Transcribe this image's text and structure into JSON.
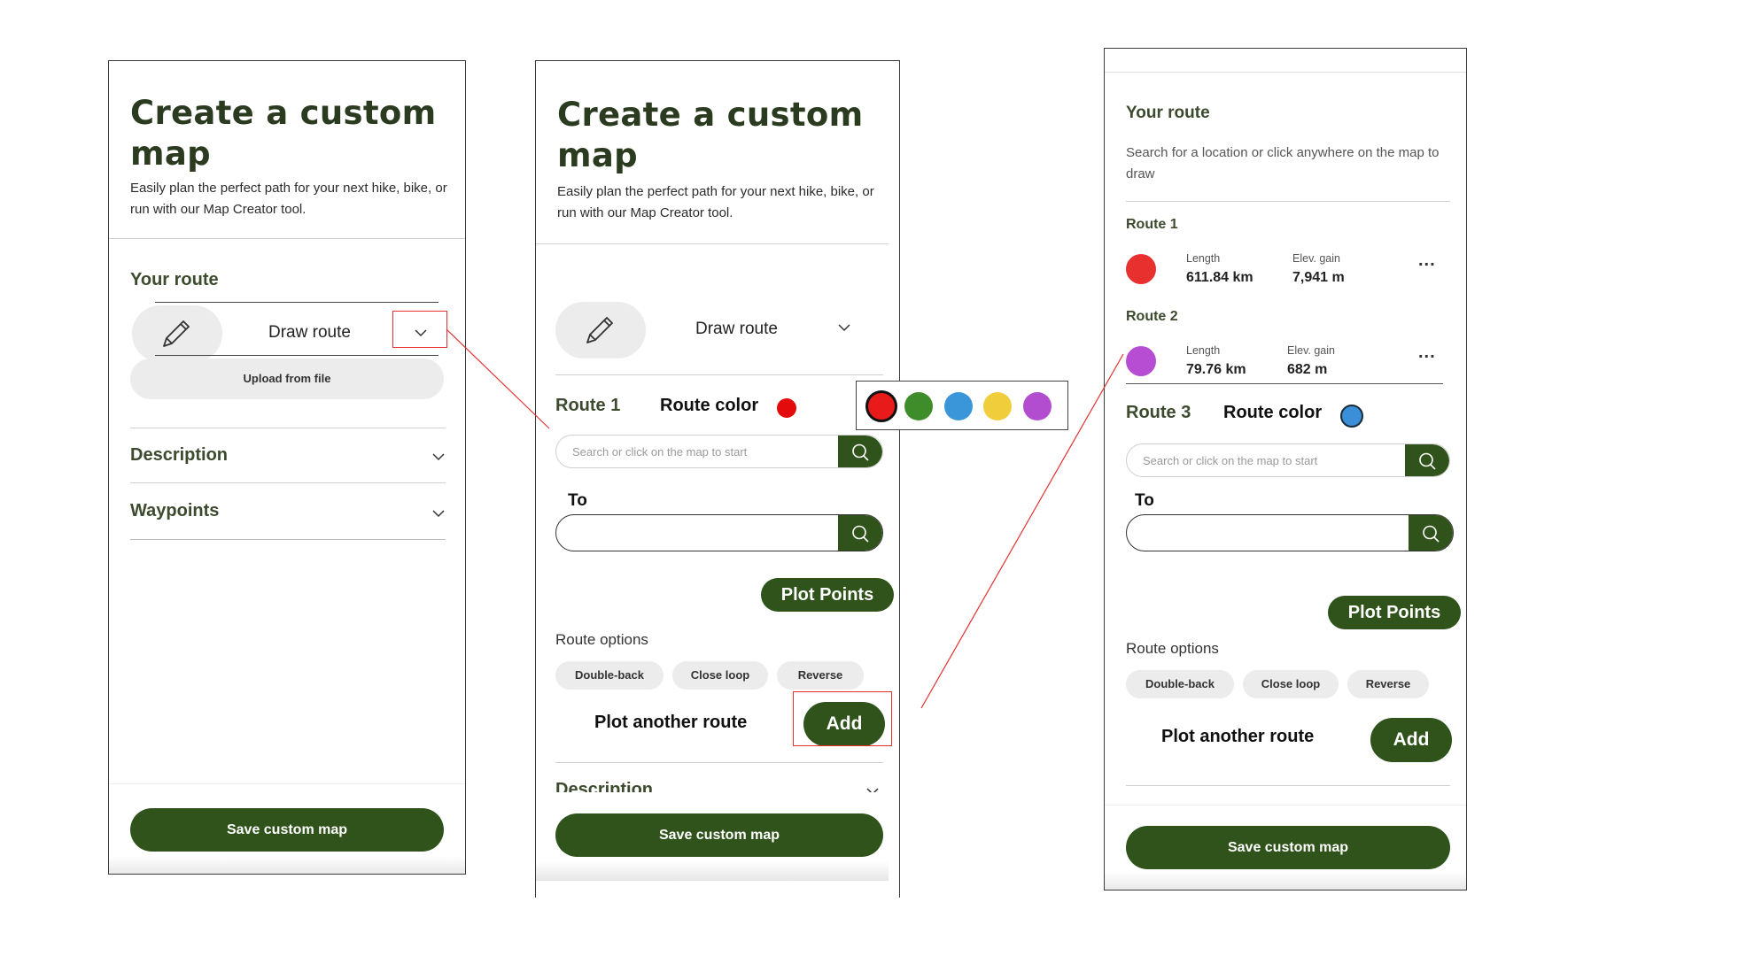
{
  "panel1": {
    "title": "Create a custom map",
    "subtitle": "Easily plan the perfect path for your next hike, bike, or run with our Map Creator tool.",
    "your_route": "Your route",
    "draw_route": "Draw route",
    "upload_from_file": "Upload from file",
    "description": "Description",
    "waypoints": "Waypoints",
    "save": "Save custom map"
  },
  "panel2": {
    "title": "Create a custom map",
    "subtitle": "Easily plan the perfect path for your next hike, bike, or run with our Map Creator tool.",
    "draw_route": "Draw route",
    "route_name": "Route 1",
    "route_color_label": "Route color",
    "route_color": "#e30b0b",
    "palette": [
      "#e81a1a",
      "#3f8c2a",
      "#3a96d8",
      "#f0cd3a",
      "#b24dd0"
    ],
    "search_placeholder": "Search or click on the map to start",
    "to_label": "To",
    "plot_points": "Plot Points",
    "route_options": "Route options",
    "options": [
      "Double-back",
      "Close loop",
      "Reverse"
    ],
    "plot_another": "Plot another route",
    "add": "Add",
    "description": "Description",
    "save": "Save custom map"
  },
  "panel3": {
    "your_route": "Your route",
    "hint": "Search for a location or click anywhere on the map to draw",
    "routes": [
      {
        "name": "Route 1",
        "color": "#e8302e",
        "length_label": "Length",
        "length": "611.84 km",
        "elev_label": "Elev. gain",
        "elev": "7,941 m",
        "more": "..."
      },
      {
        "name": "Route 2",
        "color": "#b64dd3",
        "length_label": "Length",
        "length": "79.76 km",
        "elev_label": "Elev. gain",
        "elev": "682 m",
        "more": "..."
      }
    ],
    "route3_name": "Route 3",
    "route_color_label": "Route color",
    "route3_color": "#3a8fd8",
    "search_placeholder": "Search or click on the map to start",
    "to_label": "To",
    "plot_points": "Plot Points",
    "route_options": "Route options",
    "options": [
      "Double-back",
      "Close loop",
      "Reverse"
    ],
    "plot_another": "Plot another route",
    "add": "Add",
    "save": "Save custom map"
  },
  "colors": {
    "brand_green": "#2f531a",
    "annotation_red": "#e53030"
  }
}
